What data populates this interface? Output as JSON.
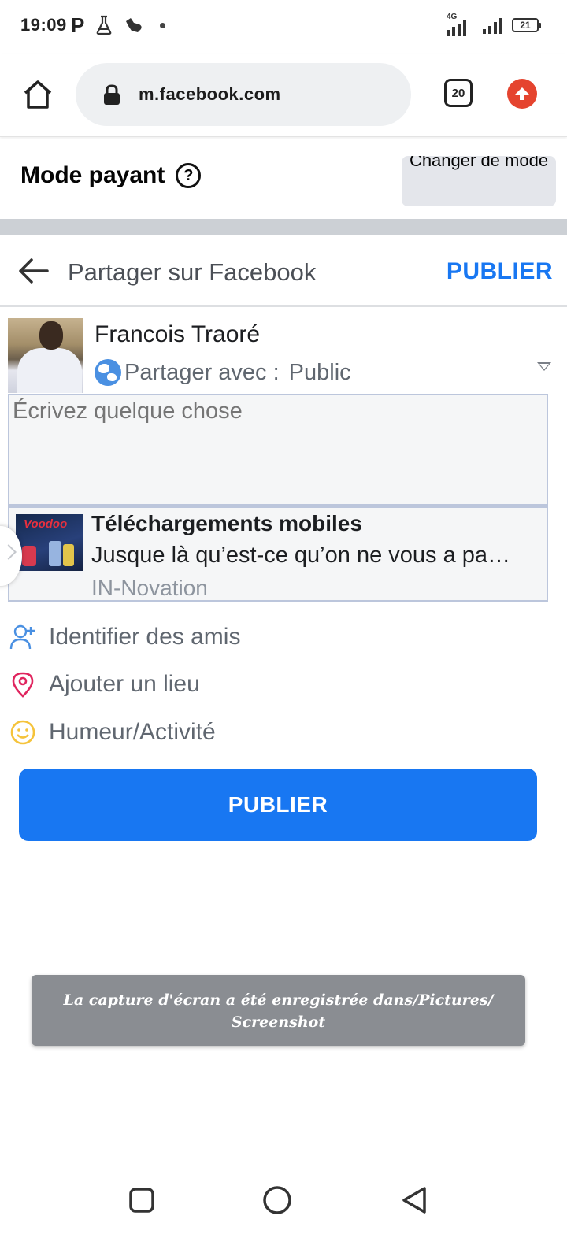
{
  "status_bar": {
    "time": "19:09",
    "indicator_p": "P",
    "network_label": "4G",
    "battery_level": "21"
  },
  "browser": {
    "url": "m.facebook.com",
    "tab_count": "20"
  },
  "mode_bar": {
    "title": "Mode payant",
    "help_symbol": "?",
    "change_mode_label": "Changer de mode"
  },
  "share_header": {
    "title": "Partager sur Facebook",
    "publish_label": "PUBLIER"
  },
  "composer": {
    "user_name": "Francois Traoré",
    "share_with_label": "Partager avec :",
    "share_with_value": "Public",
    "placeholder": "Écrivez quelque chose"
  },
  "link_preview": {
    "thumb_title": "Voodoo",
    "title": "Téléchargements mobiles",
    "description": "Jusque là qu’est-ce qu’on ne vous a pa…",
    "source": "IN-Novation"
  },
  "options": [
    {
      "label": "Identifier des amis",
      "icon": "add-friend-icon",
      "color": "#4a90e2"
    },
    {
      "label": "Ajouter un lieu",
      "icon": "location-pin-icon",
      "color": "#e0245e"
    },
    {
      "label": "Humeur/Activité",
      "icon": "smiley-icon",
      "color": "#f5c33b"
    }
  ],
  "publish_button_label": "PUBLIER",
  "toast": {
    "line1": "La capture d'écran a été enregistrée dans/Pictures/",
    "line2": "Screenshot"
  },
  "colors": {
    "facebook_blue": "#1877f2",
    "upgrade_red": "#e5442f",
    "toast_gray": "#8a8d92",
    "divider_gray": "#ccd0d5"
  }
}
